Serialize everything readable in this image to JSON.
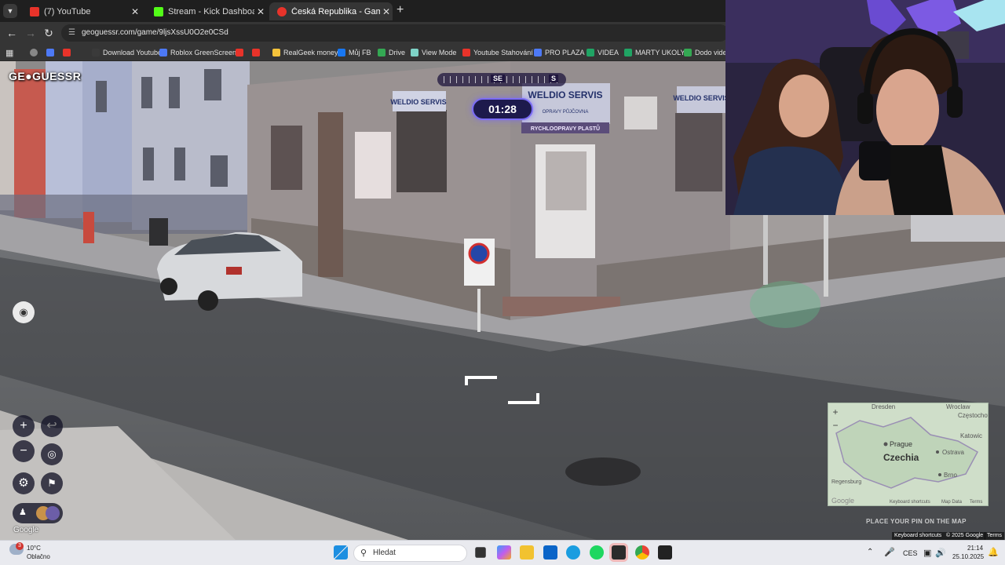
{
  "browser": {
    "tabs": [
      {
        "title": "(7) YouTube",
        "favicon_color": "#e8332a"
      },
      {
        "title": "Stream - Kick Dashboard",
        "favicon_color": "#53fc18"
      },
      {
        "title": "Česká Republika - Game - Geo",
        "favicon_color": "#e8332a"
      }
    ],
    "url": "geoguessr.com/game/9ljsXssU0O2e0CSd",
    "bookmarks": [
      {
        "label": "",
        "color": "#e8332a"
      },
      {
        "label": "Download Youtube...",
        "color": "#3a3a3a"
      },
      {
        "label": "Roblox GreenScreen",
        "color": "#4d79f6"
      },
      {
        "label": "",
        "color": "#e8332a"
      },
      {
        "label": "",
        "color": "#e8332a"
      },
      {
        "label": "RealGeek money",
        "color": "#f5c33b"
      },
      {
        "label": "Můj FB",
        "color": "#1877f2"
      },
      {
        "label": "Drive",
        "color": "#34a853"
      },
      {
        "label": "View Mode",
        "color": "#7fd3c7"
      },
      {
        "label": "Youtube Stahování",
        "color": "#e8332a"
      },
      {
        "label": "PRO PLAZA",
        "color": "#4d79f6"
      },
      {
        "label": "VIDEA",
        "color": "#20a464"
      },
      {
        "label": "MARTY UKOLY",
        "color": "#20a464"
      },
      {
        "label": "Dodo video",
        "color": "#34a853"
      }
    ]
  },
  "game": {
    "logo": "GE●GUESSR",
    "compass": {
      "primary": "SE",
      "secondary": "S"
    },
    "timer": "01:28",
    "controls": {
      "zoom_in": "+",
      "zoom_out": "−",
      "undo": "↩"
    },
    "google_mark": "Google",
    "place_pin_hint": "PLACE YOUR PIN ON THE MAP",
    "street_credits": {
      "shortcuts": "Keyboard shortcuts",
      "copyright": "© 2025 Google",
      "terms": "Terms"
    },
    "signs": {
      "shop": "WELDIO SERVIS",
      "shop_sub": "RYCHLOOPRAVY PLASTŮ",
      "shop_line": "OPRAVY  PŮJČOVNA"
    }
  },
  "minimap": {
    "country": "Czechia",
    "cities": [
      "Dresden",
      "Wroclaw",
      "Częstochow",
      "Prague",
      "Katowic",
      "Ostrava",
      "Brno",
      "Regensburg"
    ],
    "footer": {
      "shortcuts": "Keyboard shortcuts",
      "mapdata": "Map Data",
      "terms": "Terms",
      "brand": "Google"
    }
  },
  "taskbar": {
    "weather_temp": "10°C",
    "weather_desc": "Oblačno",
    "weather_badge": "3",
    "search_placeholder": "Hledat",
    "language": "CES",
    "time": "21:14",
    "date": "25.10.2025"
  },
  "colors": {
    "timer_border": "#7b6cf6",
    "taskbar_bg": "#e9eaef",
    "chrome_bg": "#353535"
  }
}
